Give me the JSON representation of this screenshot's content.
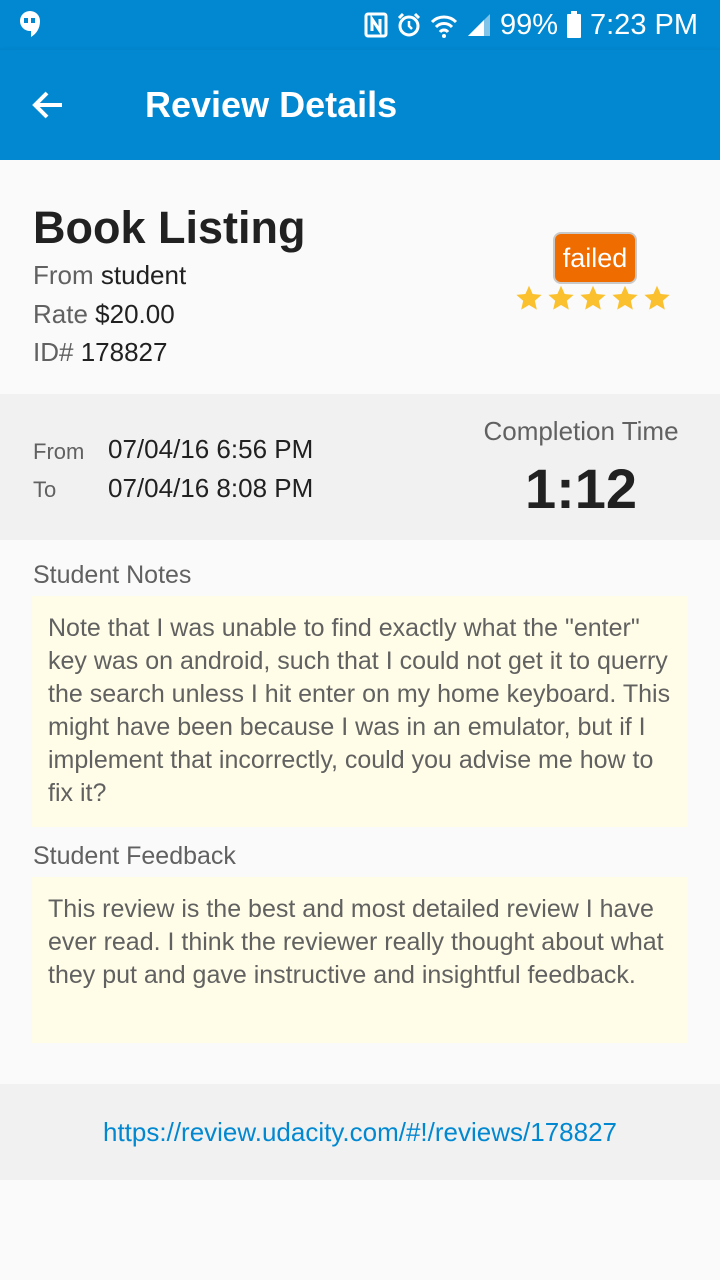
{
  "status_bar": {
    "battery": "99%",
    "time": "7:23 PM",
    "icons": [
      "hangouts-icon",
      "nfc-icon",
      "alarm-icon",
      "wifi-icon",
      "signal-icon",
      "battery-icon"
    ]
  },
  "app_bar": {
    "title": "Review Details",
    "back_icon": "arrow-back-icon",
    "color": "#0288d1"
  },
  "review": {
    "title": "Book Listing",
    "from_label": "From",
    "from_value": "student",
    "rate_label": "Rate",
    "rate_value": "$20.00",
    "id_label": "ID#",
    "id_value": "178827",
    "status": "failed",
    "status_color": "#ef6c00",
    "rating": 5,
    "rating_max": 5,
    "star_color": "#fbc02d"
  },
  "times": {
    "from_label": "From",
    "from_value": "07/04/16 6:56 PM",
    "to_label": "To",
    "to_value": "07/04/16 8:08 PM",
    "completion_label": "Completion Time",
    "completion_value": "1:12"
  },
  "student_notes": {
    "label": "Student Notes",
    "text": "Note that I was unable to find exactly what the \"enter\" key was on android, such that I could not get it to querry the search unless I hit enter on my home keyboard. This might have been because I was in an emulator, but if I implement that incorrectly, could you advise me how to fix it?"
  },
  "student_feedback": {
    "label": "Student Feedback",
    "text": "This review is the best and most detailed review I have ever read. I think the reviewer really thought about what they put and gave instructive and insightful feedback."
  },
  "link": {
    "text": "https://review.udacity.com/#!/reviews/178827"
  }
}
